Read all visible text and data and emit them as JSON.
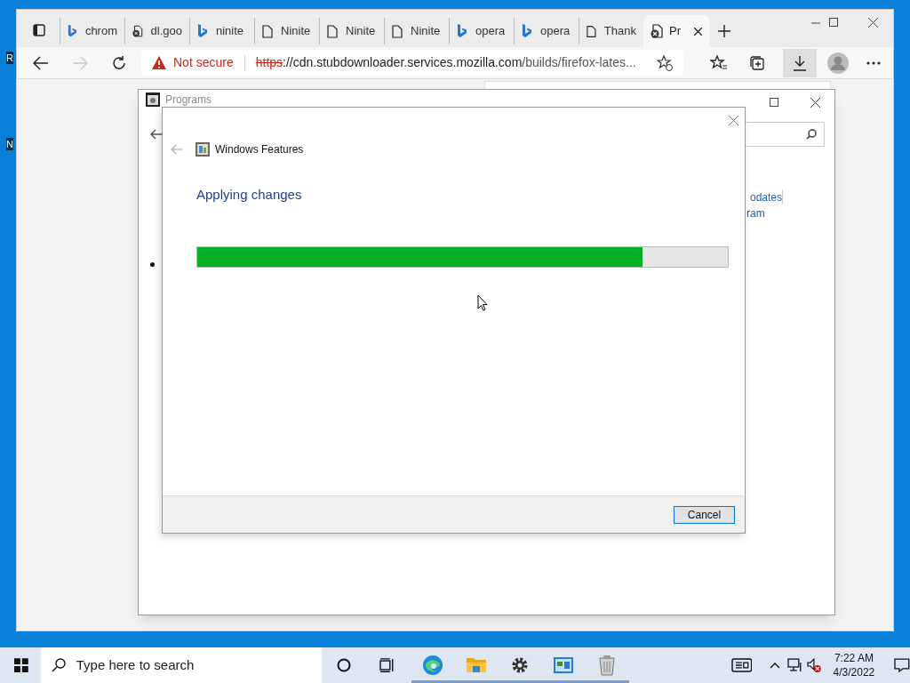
{
  "desktop": {
    "edge_labels": [
      "R",
      "N"
    ]
  },
  "browser": {
    "tabs": [
      {
        "label": "chrom",
        "kind": "bing",
        "selected": false
      },
      {
        "label": "dl.goo",
        "kind": "blocked",
        "selected": false
      },
      {
        "label": "ninite",
        "kind": "bing",
        "selected": false
      },
      {
        "label": "Ninite",
        "kind": "page",
        "selected": false
      },
      {
        "label": "Ninite",
        "kind": "page",
        "selected": false
      },
      {
        "label": "Ninite",
        "kind": "page",
        "selected": false
      },
      {
        "label": "opera",
        "kind": "bing",
        "selected": false
      },
      {
        "label": "opera",
        "kind": "bing",
        "selected": false
      },
      {
        "label": "Thank",
        "kind": "page",
        "selected": false
      },
      {
        "label": "Pr",
        "kind": "blocked",
        "selected": true
      }
    ],
    "security": "Not secure",
    "url_scheme": "https",
    "url_host": "://cdn.stubdownloader.services.mozilla.com",
    "url_path": "/builds/firefox-lates..."
  },
  "programs_window": {
    "title": "Programs",
    "links": [
      "odates",
      "ram"
    ]
  },
  "dialog": {
    "title": "Windows Features",
    "heading": "Applying changes",
    "progress": {
      "level": 0.84
    },
    "buttons": [
      "Cancel"
    ]
  },
  "taskbar": {
    "search_placeholder": "Type here to search",
    "apps": [
      {
        "kind": "edge",
        "running": true
      },
      {
        "kind": "folder",
        "running": true
      },
      {
        "kind": "gear",
        "running": true
      },
      {
        "kind": "control-panel",
        "running": true
      },
      {
        "kind": "bin",
        "running": true
      }
    ],
    "time": "7:22 AM",
    "date": "4/3/2022"
  }
}
